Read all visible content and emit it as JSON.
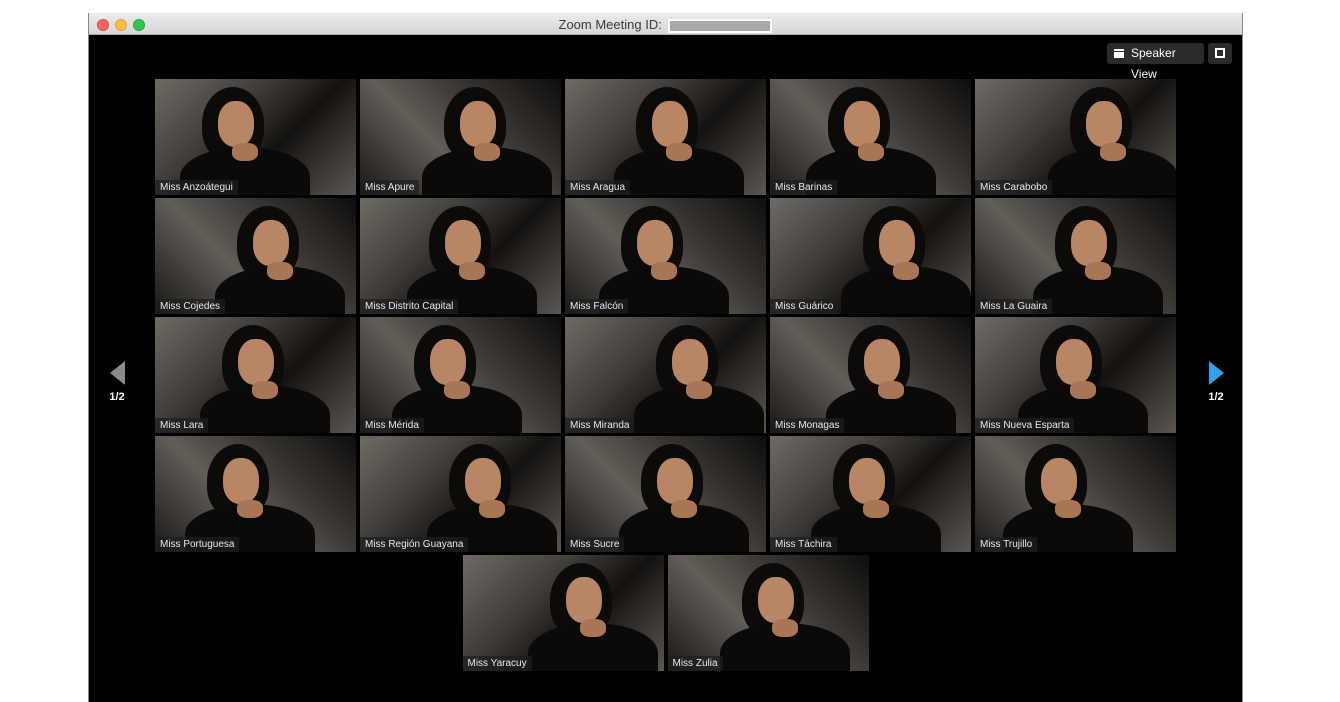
{
  "window": {
    "title_prefix": "Zoom Meeting ID:"
  },
  "toolbar": {
    "speaker_view_label": "Speaker View",
    "speaker_view_icon": "speaker-view-icon",
    "fullscreen_icon": "fullscreen-icon"
  },
  "pagination": {
    "prev_label": "1/2",
    "next_label": "1/2",
    "prev_color": "#8a8a8a",
    "next_color": "#2ea3e8"
  },
  "participants": [
    "Miss Anzoátegui",
    "Miss Apure",
    "Miss Aragua",
    "Miss Barinas",
    "Miss Carabobo",
    "Miss Cojedes",
    "Miss Distrito Capital",
    "Miss Falcón",
    "Miss Guárico",
    "Miss La Guaira",
    "Miss Lara",
    "Miss Mérida",
    "Miss Miranda",
    "Miss Monagas",
    "Miss Nueva Esparta",
    "Miss Portuguesa",
    "Miss Región Guayana",
    "Miss Sucre",
    "Miss Táchira",
    "Miss Trujillo",
    "Miss Yaracuy",
    "Miss Zulia"
  ]
}
